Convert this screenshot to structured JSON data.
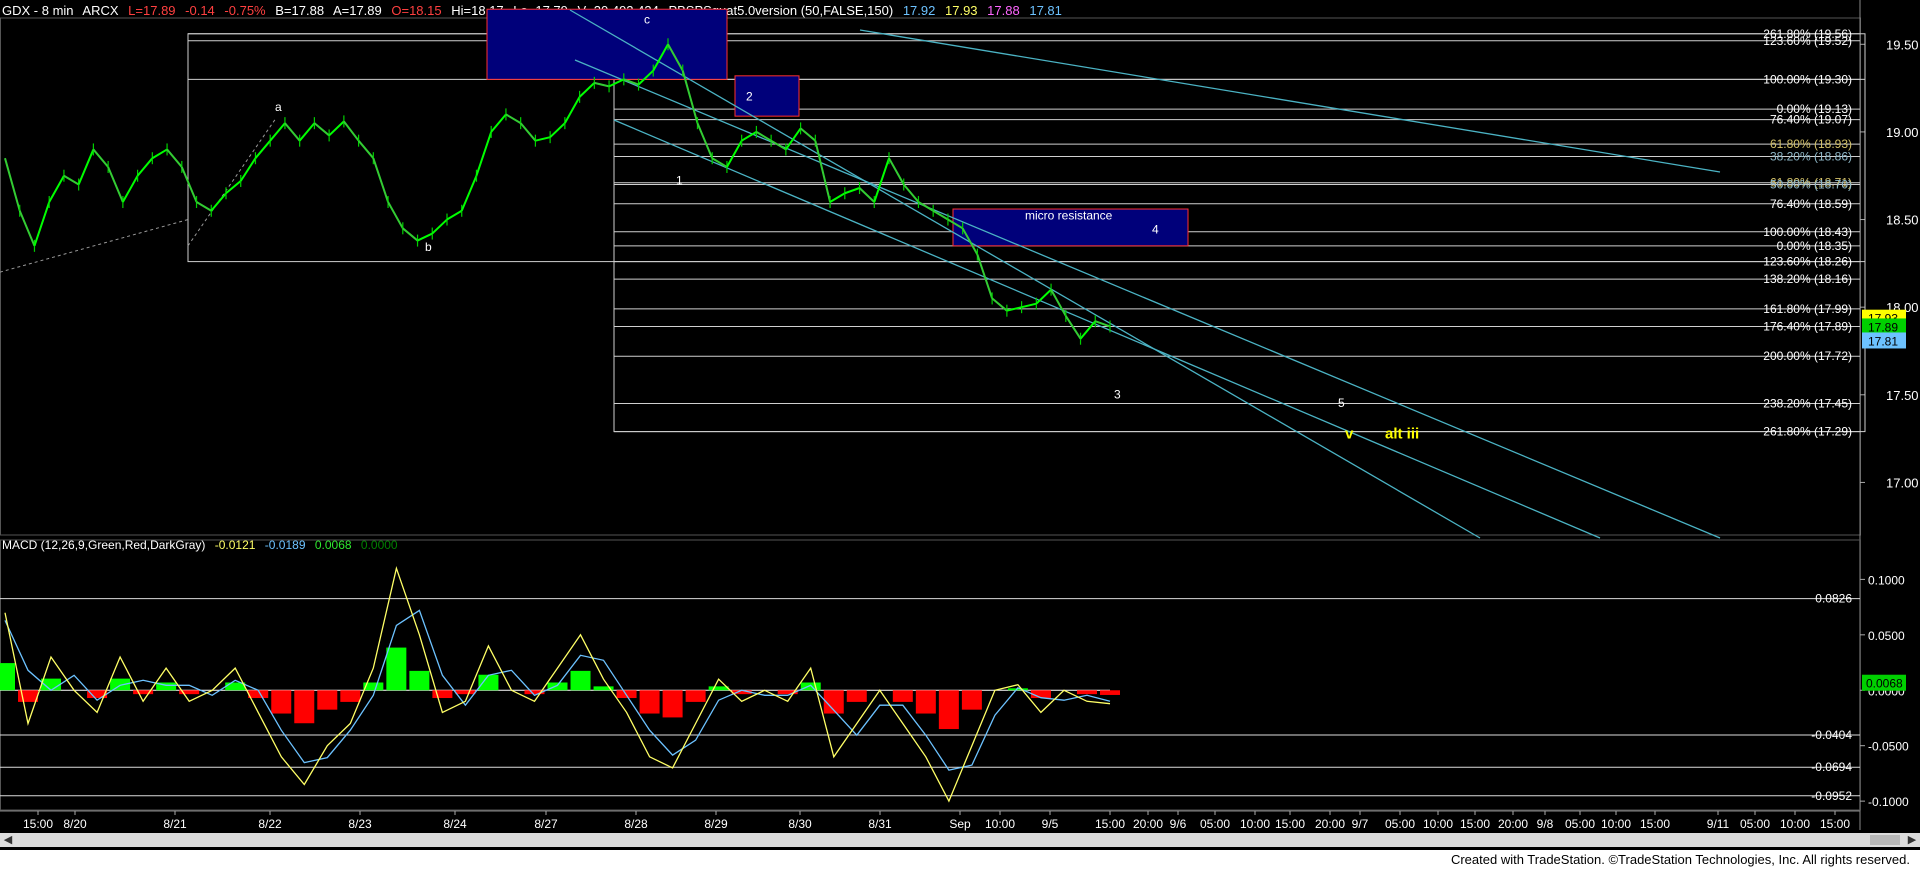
{
  "header": {
    "symbol": "GDX - 8 min",
    "exchange": "ARCX",
    "last": "L=17.89",
    "change": "-0.14",
    "change_pct": "-0.75%",
    "bid": "B=17.88",
    "ask": "A=17.89",
    "open": "O=18.15",
    "high": "Hi=18.17",
    "low": "Lo=17.79",
    "volume": "V=20,492,434",
    "study": "PBSPSquat5.0version (50,FALSE,150)",
    "study_values": [
      "17.92",
      "17.93",
      "17.88",
      "17.81"
    ],
    "study_colors": [
      "#6cc2ff",
      "#ffff66",
      "#ff66ff",
      "#6cc2ff"
    ]
  },
  "macd_header": {
    "label": "MACD (12,26,9,Green,Red,DarkGray)",
    "values": [
      "-0.0121",
      "-0.0189",
      "0.0068",
      "0.0000"
    ],
    "colors": [
      "#ffff66",
      "#6cc2ff",
      "#2ee82e",
      "#008000"
    ]
  },
  "colors": {
    "up": "#00ff00",
    "down": "#ff0000",
    "text": "#ffffff",
    "fib_lines": "#cfcfcf",
    "channel": "#4bb3c4",
    "resistance_box": "#00007a",
    "box_border": "#ff3030",
    "last_price_tag": "#ffff00",
    "macd_line": "#ffff66",
    "signal_line": "#6cc2ff",
    "hist_up": "#00ff00",
    "hist_down": "#ff0000"
  },
  "footer": "Created with TradeStation. ©TradeStation Technologies, Inc. All rights reserved.",
  "chart_data": [
    {
      "type": "line",
      "title": "GDX - 8 min",
      "y_axis_ticks": [
        "19.50",
        "19.00",
        "18.50",
        "18.00",
        "17.50",
        "17.00"
      ],
      "ylim": [
        16.7,
        19.65
      ],
      "price_tags": [
        "17.93",
        "17.89",
        "17.81"
      ],
      "x_tick_labels": [
        "15:00",
        "8/20",
        "8/21",
        "8/22",
        "8/23",
        "8/24",
        "8/27",
        "8/28",
        "8/29",
        "8/30",
        "8/31",
        "Sep",
        "10:00",
        "9/5",
        "15:00",
        "20:00",
        "9/6",
        "05:00",
        "10:00",
        "15:00",
        "20:00",
        "9/7",
        "05:00",
        "10:00",
        "15:00",
        "20:00",
        "9/8",
        "05:00",
        "10:00",
        "15:00",
        "9/11",
        "05:00",
        "10:00",
        "15:00"
      ],
      "price_path": [
        18.85,
        18.55,
        18.35,
        18.6,
        18.75,
        18.7,
        18.9,
        18.8,
        18.6,
        18.75,
        18.85,
        18.9,
        18.8,
        18.6,
        18.55,
        18.65,
        18.72,
        18.85,
        18.95,
        19.05,
        18.95,
        19.05,
        18.98,
        19.06,
        18.95,
        18.85,
        18.6,
        18.45,
        18.38,
        18.42,
        18.5,
        18.55,
        18.75,
        19.0,
        19.1,
        19.05,
        18.95,
        18.97,
        19.05,
        19.2,
        19.28,
        19.26,
        19.3,
        19.27,
        19.35,
        19.5,
        19.35,
        19.05,
        18.85,
        18.8,
        18.95,
        19.0,
        18.95,
        18.9,
        19.02,
        18.95,
        18.6,
        18.65,
        18.68,
        18.6,
        18.85,
        18.7,
        18.6,
        18.55,
        18.5,
        18.45,
        18.3,
        18.05,
        17.98,
        18.0,
        18.02,
        18.1,
        17.95,
        17.82,
        17.92,
        17.89
      ],
      "fib_levels": [
        {
          "label": "261.80% (19.56)",
          "price": 19.56
        },
        {
          "label": "123.60% (19.52)",
          "price": 19.52
        },
        {
          "label": "100.00% (19.30)",
          "price": 19.3
        },
        {
          "label": "0.00% (19.13)",
          "price": 19.13
        },
        {
          "label": "76.40% (19.07)",
          "price": 19.07
        },
        {
          "label": "61.80% (18.93)",
          "price": 18.93
        },
        {
          "label": "38.20% (18.86)",
          "price": 18.86
        },
        {
          "label": "61.80% (18.71)",
          "price": 18.71
        },
        {
          "label": "50.00% (18.70)",
          "price": 18.7
        },
        {
          "label": "76.40% (18.59)",
          "price": 18.59
        },
        {
          "label": "100.00% (18.43)",
          "price": 18.43
        },
        {
          "label": "0.00% (18.35)",
          "price": 18.35
        },
        {
          "label": "123.60% (18.26)",
          "price": 18.26
        },
        {
          "label": "138.20% (18.16)",
          "price": 18.16
        },
        {
          "label": "161.80% (17.99)",
          "price": 17.99
        },
        {
          "label": "176.40% (17.89)",
          "price": 17.89
        },
        {
          "label": "200.00% (17.72)",
          "price": 17.72
        },
        {
          "label": "238.20% (17.45)",
          "price": 17.45
        },
        {
          "label": "261.80% (17.29)",
          "price": 17.29
        }
      ],
      "wave_labels": [
        "a",
        "b",
        "c",
        "1",
        "2",
        "3",
        "4",
        "5",
        "v",
        "alt iii"
      ],
      "annotations": [
        "micro resistance"
      ]
    },
    {
      "type": "line",
      "title": "MACD (12,26,9,Green,Red,DarkGray)",
      "y_axis_ticks": [
        "0.1000",
        "0.0500",
        "0.0000",
        "-0.0500",
        "-0.1000"
      ],
      "ylim": [
        -0.108,
        0.122
      ],
      "reference_levels": [
        {
          "label": "0.0826",
          "value": 0.0826
        },
        {
          "label": "-0.0404",
          "value": -0.0404
        },
        {
          "label": "-0.0694",
          "value": -0.0694
        },
        {
          "label": "-0.0952",
          "value": -0.0952
        }
      ],
      "current_value_tag": "0.0068",
      "macd_path": [
        0.07,
        -0.03,
        0.03,
        0.0,
        -0.02,
        0.03,
        -0.01,
        0.02,
        -0.01,
        0.0,
        0.02,
        -0.02,
        -0.06,
        -0.085,
        -0.05,
        -0.03,
        0.02,
        0.11,
        0.05,
        -0.02,
        -0.01,
        0.04,
        0.0,
        -0.01,
        0.02,
        0.05,
        0.01,
        -0.02,
        -0.06,
        -0.07,
        -0.03,
        0.01,
        -0.01,
        0.0,
        -0.01,
        0.02,
        -0.06,
        -0.03,
        0.0,
        -0.03,
        -0.06,
        -0.1,
        -0.05,
        0.0,
        0.005,
        -0.02,
        0.0,
        -0.01,
        -0.0121
      ]
    }
  ]
}
